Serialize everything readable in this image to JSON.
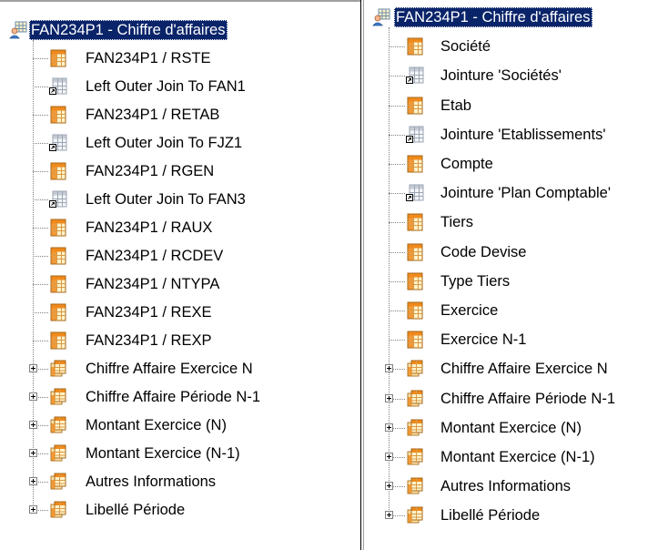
{
  "left_tree": {
    "root": {
      "label": "FAN234P1 - Chiffre d'affaires",
      "icon": "cube-user-icon"
    },
    "items": [
      {
        "label": "FAN234P1 / RSTE",
        "icon": "table-icon",
        "expandable": false
      },
      {
        "label": "Left Outer Join To FAN1",
        "icon": "join-icon",
        "expandable": false
      },
      {
        "label": "FAN234P1 / RETAB",
        "icon": "table-icon",
        "expandable": false
      },
      {
        "label": "Left Outer Join To FJZ1",
        "icon": "join-icon",
        "expandable": false
      },
      {
        "label": "FAN234P1 / RGEN",
        "icon": "table-icon",
        "expandable": false
      },
      {
        "label": "Left Outer Join To FAN3",
        "icon": "join-icon",
        "expandable": false
      },
      {
        "label": "FAN234P1 / RAUX",
        "icon": "table-icon",
        "expandable": false
      },
      {
        "label": "FAN234P1 / RCDEV",
        "icon": "table-icon",
        "expandable": false
      },
      {
        "label": "FAN234P1 / NTYPA",
        "icon": "table-icon",
        "expandable": false
      },
      {
        "label": "FAN234P1 / REXE",
        "icon": "table-icon",
        "expandable": false
      },
      {
        "label": "FAN234P1 / REXP",
        "icon": "table-icon",
        "expandable": false
      },
      {
        "label": "Chiffre Affaire Exercice N",
        "icon": "folder-table-icon",
        "expandable": true
      },
      {
        "label": "Chiffre Affaire Période N-1",
        "icon": "folder-table-icon",
        "expandable": true
      },
      {
        "label": "Montant Exercice (N)",
        "icon": "folder-table-icon",
        "expandable": true
      },
      {
        "label": "Montant Exercice (N-1)",
        "icon": "folder-table-icon",
        "expandable": true
      },
      {
        "label": "Autres Informations",
        "icon": "folder-table-icon",
        "expandable": true
      },
      {
        "label": "Libellé Période",
        "icon": "folder-table-icon",
        "expandable": true
      }
    ]
  },
  "right_tree": {
    "root": {
      "label": "FAN234P1 - Chiffre d'affaires",
      "icon": "cube-user-icon"
    },
    "items": [
      {
        "label": "Société",
        "icon": "table-icon",
        "expandable": false
      },
      {
        "label": "Jointure 'Sociétés'",
        "icon": "join-icon",
        "expandable": false
      },
      {
        "label": "Etab",
        "icon": "table-icon",
        "expandable": false
      },
      {
        "label": "Jointure 'Etablissements'",
        "icon": "join-icon",
        "expandable": false
      },
      {
        "label": "Compte",
        "icon": "table-icon",
        "expandable": false
      },
      {
        "label": "Jointure 'Plan Comptable'",
        "icon": "join-icon",
        "expandable": false
      },
      {
        "label": "Tiers",
        "icon": "table-icon",
        "expandable": false
      },
      {
        "label": "Code Devise",
        "icon": "table-icon",
        "expandable": false
      },
      {
        "label": "Type Tiers",
        "icon": "table-icon",
        "expandable": false
      },
      {
        "label": "Exercice",
        "icon": "table-icon",
        "expandable": false
      },
      {
        "label": "Exercice N-1",
        "icon": "table-icon",
        "expandable": false
      },
      {
        "label": "Chiffre Affaire Exercice N",
        "icon": "folder-table-icon",
        "expandable": true
      },
      {
        "label": "Chiffre Affaire Période N-1",
        "icon": "folder-table-icon",
        "expandable": true
      },
      {
        "label": "Montant Exercice (N)",
        "icon": "folder-table-icon",
        "expandable": true
      },
      {
        "label": "Montant Exercice (N-1)",
        "icon": "folder-table-icon",
        "expandable": true
      },
      {
        "label": "Autres Informations",
        "icon": "folder-table-icon",
        "expandable": true
      },
      {
        "label": "Libellé Période",
        "icon": "folder-table-icon",
        "expandable": true
      }
    ]
  },
  "colors": {
    "selection_bg": "#0a246a",
    "selection_text": "#ffffff",
    "tree_lines": "#808080",
    "table_icon_orange": "#f08a1c",
    "table_icon_cream": "#fff2c8",
    "join_icon_gray": "#9ca6b3"
  }
}
